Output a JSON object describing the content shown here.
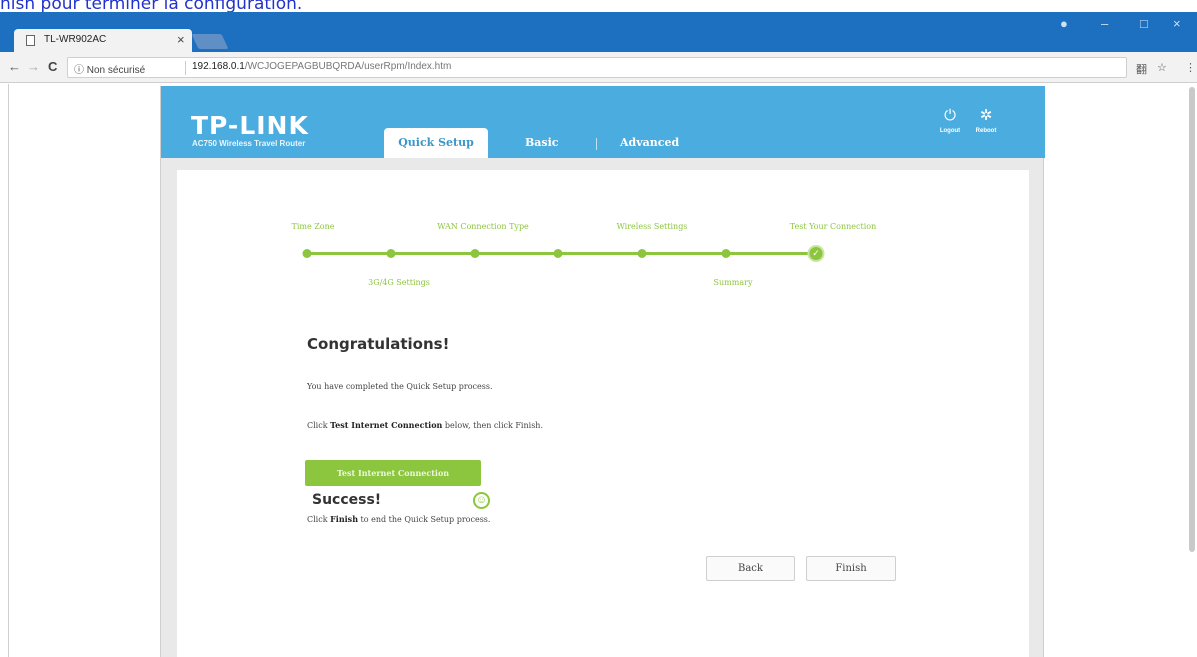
{
  "caption": "nish pour terminer la configuration.",
  "browser": {
    "tab_title": "TL-WR902AC",
    "tab_close": "×",
    "security_label": "ⓘ Non sécurisé",
    "url_host": "192.168.0.1",
    "url_path": "/WCJOGEPAGBUBQRDA/userRpm/Index.htm",
    "window_controls": {
      "profile": "●",
      "minimize": "–",
      "maximize": "□",
      "close": "×"
    }
  },
  "header": {
    "logo": "TP-LINK",
    "model": "AC750 Wireless Travel Router",
    "nav": {
      "quick_setup": "Quick Setup",
      "basic": "Basic",
      "advanced": "Advanced"
    },
    "logout_label": "Logout",
    "reboot_label": "Reboot"
  },
  "steps": {
    "top_labels": [
      "Time Zone",
      "WAN Connection Type",
      "Wireless Settings",
      "Test Your Connection"
    ],
    "bottom_labels": [
      "3G/4G Settings",
      "Summary"
    ]
  },
  "content": {
    "heading": "Congratulations!",
    "completed_text": "You have completed the Quick Setup process.",
    "instruction_prefix": "Click ",
    "instruction_bold": "Test Internet Connection",
    "instruction_suffix": " below, then click Finish.",
    "test_button": "Test Internet Connection",
    "success_heading": "Success!",
    "success_prefix": "Click ",
    "success_bold": "Finish",
    "success_suffix": " to end the Quick Setup process."
  },
  "buttons": {
    "back": "Back",
    "finish": "Finish"
  },
  "colors": {
    "header_blue": "#4aacdf",
    "accent_green": "#8cc63e",
    "chrome_blue": "#1d6fbf"
  }
}
